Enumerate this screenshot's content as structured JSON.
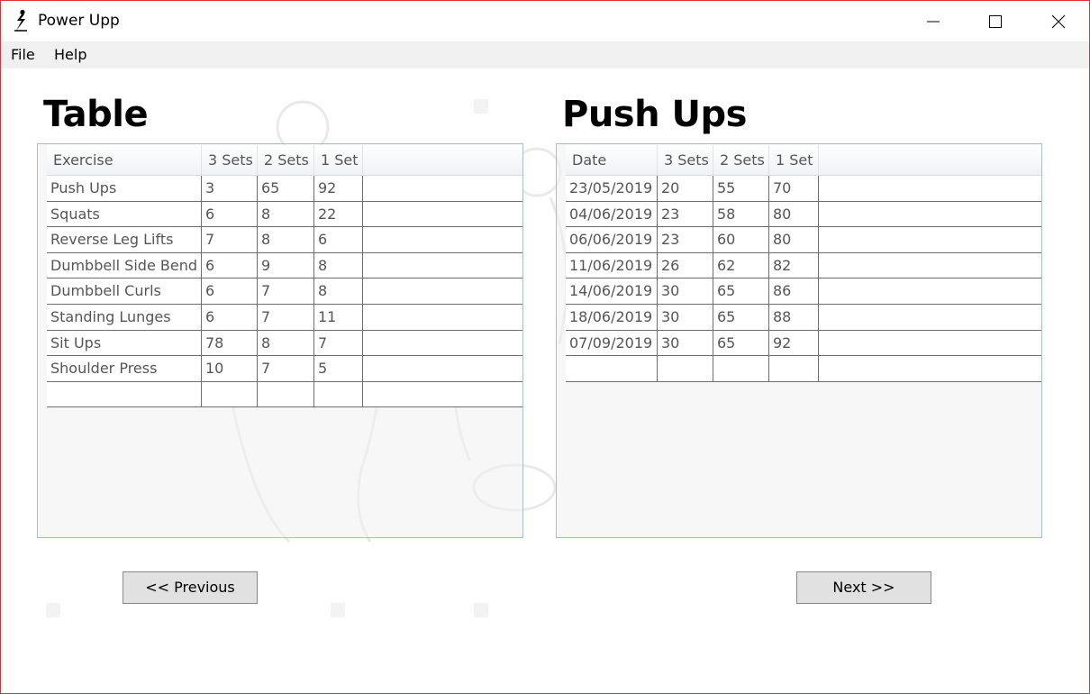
{
  "window": {
    "title": "Power Upp",
    "icon": "lightning-person-icon",
    "controls": [
      "minimize-icon",
      "maximize-icon",
      "close-icon"
    ]
  },
  "menu": {
    "items": [
      {
        "label": "File"
      },
      {
        "label": "Help"
      }
    ]
  },
  "left_panel": {
    "heading": "Table",
    "columns": [
      "Exercise",
      "3 Sets",
      "2 Sets",
      "1 Set"
    ],
    "rows": [
      [
        "Push Ups",
        "3",
        "65",
        "92"
      ],
      [
        "Squats",
        "6",
        "8",
        "22"
      ],
      [
        "Reverse Leg Lifts",
        "7",
        "8",
        "6"
      ],
      [
        "Dumbbell Side Bend",
        "6",
        "9",
        "8"
      ],
      [
        "Dumbbell Curls",
        "6",
        "7",
        "8"
      ],
      [
        "Standing Lunges",
        "6",
        "7",
        "11"
      ],
      [
        "Sit Ups",
        "78",
        "8",
        "7"
      ],
      [
        "Shoulder Press",
        "10",
        "7",
        "5"
      ],
      [
        "",
        "",
        "",
        ""
      ]
    ]
  },
  "right_panel": {
    "heading": "Push Ups",
    "columns": [
      "Date",
      "3 Sets",
      "2 Sets",
      "1 Set"
    ],
    "rows": [
      [
        "23/05/2019",
        "20",
        "55",
        "70"
      ],
      [
        "04/06/2019",
        "23",
        "58",
        "80"
      ],
      [
        "06/06/2019",
        "23",
        "60",
        "80"
      ],
      [
        "11/06/2019",
        "26",
        "62",
        "82"
      ],
      [
        "14/06/2019",
        "30",
        "65",
        "86"
      ],
      [
        "18/06/2019",
        "30",
        "65",
        "88"
      ],
      [
        "07/09/2019",
        "30",
        "65",
        "92"
      ],
      [
        "",
        "",
        "",
        ""
      ]
    ]
  },
  "buttons": {
    "previous": "<< Previous",
    "next": "Next >>"
  },
  "colors": {
    "window_border": "#e0303a",
    "menubar_bg": "#f0f0f0",
    "grid_border": "#a9bbd0",
    "button_bg": "#e1e1e1"
  }
}
